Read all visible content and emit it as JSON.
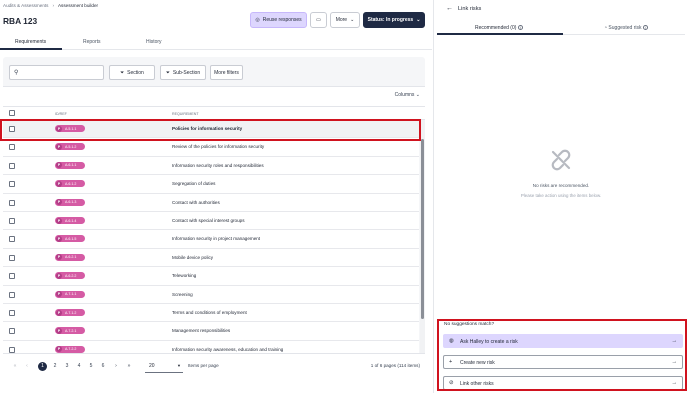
{
  "breadcrumb": {
    "root": "Audits & Assessments",
    "sep": "›",
    "current": "Assessment builder"
  },
  "page_title": "RBA 123",
  "header_buttons": {
    "reuse": "Reuse responses",
    "more": "More",
    "status": "Status: In progress"
  },
  "tabs": [
    {
      "label": "Requirements",
      "active": true
    },
    {
      "label": "Reports",
      "active": false
    },
    {
      "label": "History",
      "active": false
    }
  ],
  "filters": {
    "search_placeholder": "",
    "section": "Section",
    "subsection": "Sub-Section",
    "more_filters": "More filters"
  },
  "columns_label": "Columns",
  "table_headers": {
    "id": "ID/REF",
    "requirement": "REQUIREMENT"
  },
  "rows": [
    {
      "prefix": "P",
      "id": "A.5.1.1",
      "requirement": "Policies for information security"
    },
    {
      "prefix": "P",
      "id": "A.5.1.2",
      "requirement": "Review of the policies for information security"
    },
    {
      "prefix": "P",
      "id": "A.6.1.1",
      "requirement": "Information security roles and responsibilities"
    },
    {
      "prefix": "P",
      "id": "A.6.1.2",
      "requirement": "Segregation of duties"
    },
    {
      "prefix": "P",
      "id": "A.6.1.3",
      "requirement": "Contact with authorities"
    },
    {
      "prefix": "P",
      "id": "A.6.1.4",
      "requirement": "Contact with special interest groups"
    },
    {
      "prefix": "P",
      "id": "A.6.1.5",
      "requirement": "Information security in project management"
    },
    {
      "prefix": "P",
      "id": "A.6.2.1",
      "requirement": "Mobile device policy"
    },
    {
      "prefix": "P",
      "id": "A.6.2.2",
      "requirement": "Teleworking"
    },
    {
      "prefix": "P",
      "id": "A.7.1.1",
      "requirement": "Screening"
    },
    {
      "prefix": "P",
      "id": "A.7.1.2",
      "requirement": "Terms and conditions of employment"
    },
    {
      "prefix": "P",
      "id": "A.7.2.1",
      "requirement": "Management responsibilities"
    },
    {
      "prefix": "P",
      "id": "A.7.2.2",
      "requirement": "Information security awareness, education and training"
    }
  ],
  "pagination": {
    "first": "«",
    "prev": "‹",
    "pages": [
      "1",
      "2",
      "3",
      "4",
      "5",
      "6"
    ],
    "next": "›",
    "last": "»",
    "items_per_page": "20",
    "items_per_page_label": "Items per page",
    "info": "1 of 6 pages (114 items)"
  },
  "panel": {
    "back": "←",
    "title": "Link risks",
    "tab_recommended": "Recommended (0)",
    "tab_suggested": "Suggested risk",
    "empty_title": "No risks are recommended.",
    "empty_sub": "Please take action using the items below.",
    "no_match": "No suggestions match?",
    "actions": [
      {
        "label": "Ask Halley to create a risk",
        "icon": "ai-icon",
        "glyph": "◍"
      },
      {
        "label": "Create new risk",
        "icon": "plus-icon",
        "glyph": "+"
      },
      {
        "label": "Link other risks",
        "icon": "link-icon",
        "glyph": "⊘"
      }
    ],
    "arrow": "→"
  },
  "colors": {
    "accent": "#1f2a44",
    "highlight": "#d0131f",
    "pill": "#d55ba4",
    "ai": "#ddd6fe"
  }
}
